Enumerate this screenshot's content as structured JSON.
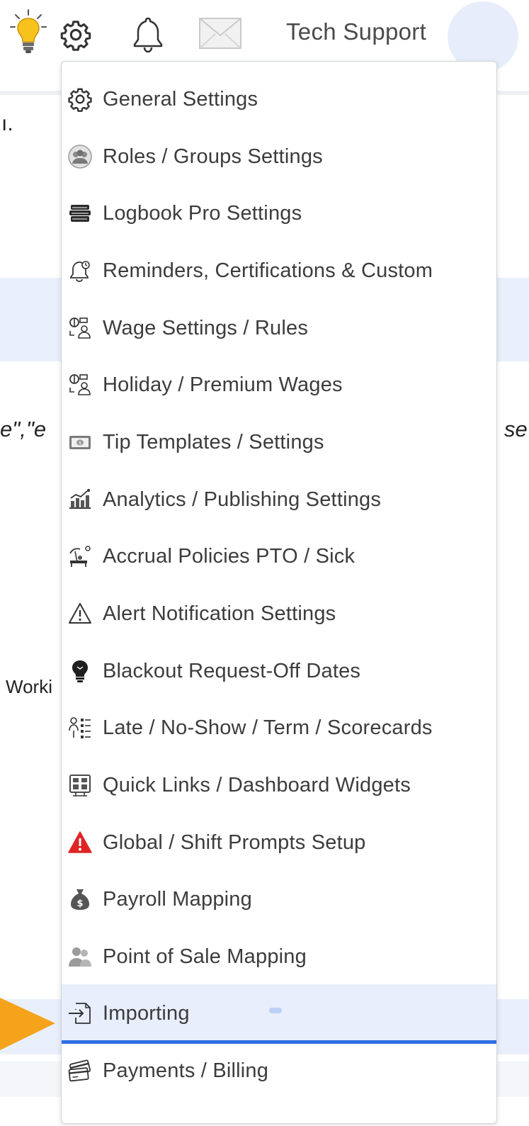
{
  "header": {
    "user_name": "Tech Support",
    "icons": [
      "lightbulb-icon",
      "gear-icon",
      "bell-icon",
      "mail-icon"
    ]
  },
  "background": {
    "fragments": [
      "ı.",
      "e\",\"e",
      "se",
      "Worki"
    ]
  },
  "menu": {
    "items": [
      {
        "label": "General Settings",
        "icon": "gear-icon"
      },
      {
        "label": "Roles / Groups Settings",
        "icon": "groups-icon"
      },
      {
        "label": "Logbook Pro Settings",
        "icon": "logbook-icon"
      },
      {
        "label": "Reminders, Certifications & Custom",
        "icon": "reminder-bell-icon"
      },
      {
        "label": "Wage Settings / Rules",
        "icon": "wage-icon"
      },
      {
        "label": "Holiday / Premium Wages",
        "icon": "holiday-wage-icon"
      },
      {
        "label": "Tip Templates / Settings",
        "icon": "tip-money-icon"
      },
      {
        "label": "Analytics / Publishing Settings",
        "icon": "analytics-icon"
      },
      {
        "label": "Accrual Policies PTO / Sick",
        "icon": "accrual-icon"
      },
      {
        "label": "Alert Notification Settings",
        "icon": "alert-triangle-icon"
      },
      {
        "label": "Blackout Request-Off Dates",
        "icon": "blackout-bulb-icon"
      },
      {
        "label": "Late / No-Show / Term / Scorecards",
        "icon": "scorecard-icon"
      },
      {
        "label": "Quick Links / Dashboard Widgets",
        "icon": "dashboard-widgets-icon"
      },
      {
        "label": "Global / Shift Prompts Setup",
        "icon": "warning-red-icon"
      },
      {
        "label": "Payroll Mapping",
        "icon": "money-bag-icon"
      },
      {
        "label": "Point of Sale Mapping",
        "icon": "people-icon"
      },
      {
        "label": "Importing",
        "icon": "import-icon",
        "active": true
      },
      {
        "label": "Payments / Billing",
        "icon": "credit-cards-icon"
      }
    ]
  },
  "colors": {
    "active_bg": "#e8eefb",
    "active_underline": "#2f6fe4",
    "pointer_arrow": "#f5a31a",
    "warning_red": "#e02424"
  }
}
